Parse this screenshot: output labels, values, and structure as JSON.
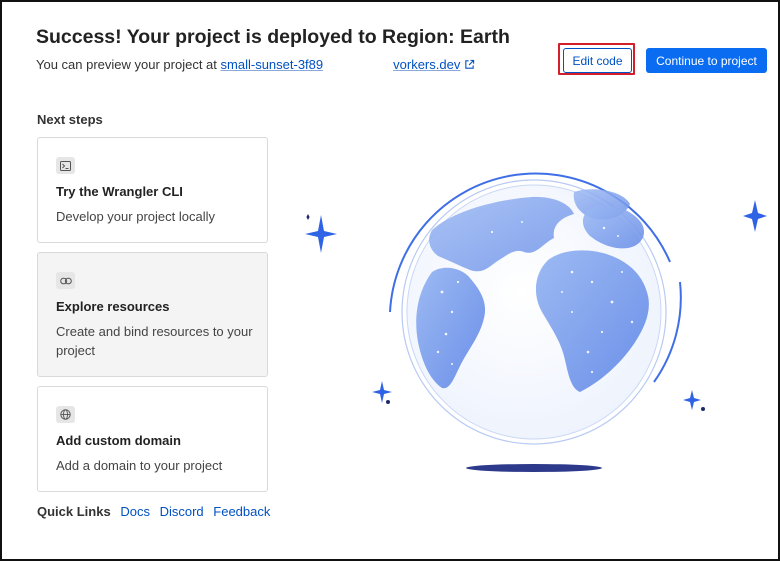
{
  "header": {
    "title": "Success! Your project is deployed to Region: Earth",
    "preview_prefix": "You can preview your project at",
    "preview_link_part1": "small-sunset-3f89",
    "preview_link_part2": "vorkers.dev",
    "edit_code_label": "Edit code",
    "continue_label": "Continue to project"
  },
  "next_steps": {
    "heading": "Next steps",
    "cards": [
      {
        "icon": "terminal-icon",
        "title": "Try the Wrangler CLI",
        "description": "Develop your project locally"
      },
      {
        "icon": "link-icon",
        "title": "Explore resources",
        "description": "Create and bind resources to your project"
      },
      {
        "icon": "globe-icon",
        "title": "Add custom domain",
        "description": "Add a domain to your project"
      }
    ]
  },
  "quick_links": {
    "label": "Quick Links",
    "links": [
      "Docs",
      "Discord",
      "Feedback"
    ]
  },
  "colors": {
    "accent": "#0a6cf0",
    "link": "#0051c3",
    "highlight": "#d21f2b",
    "globe_land": "#7fa3ee",
    "globe_ring": "#3f6fe6",
    "sparkle": "#2f63e6"
  }
}
